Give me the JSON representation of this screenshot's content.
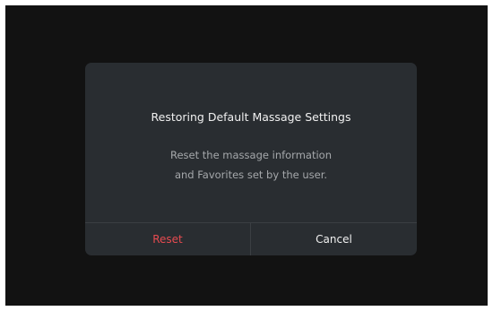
{
  "dialog": {
    "title": "Restoring Default Massage Settings",
    "message_line1": "Reset the massage information",
    "message_line2": "and Favorites set by the user.",
    "buttons": {
      "reset_label": "Reset",
      "cancel_label": "Cancel"
    }
  },
  "colors": {
    "screen_background": "#121212",
    "dialog_background": "#292d31",
    "destructive_accent": "#e64b50",
    "primary_text": "#f0f0f0",
    "secondary_text": "#a5a8ab"
  }
}
